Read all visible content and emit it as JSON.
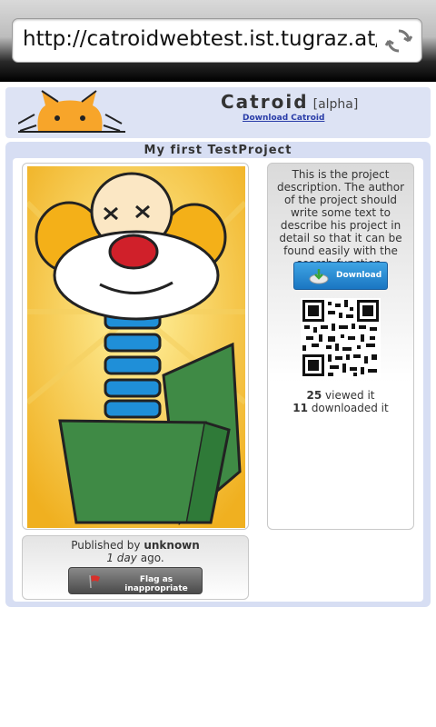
{
  "browser": {
    "url": "http://catroidwebtest.ist.tugraz.at/..."
  },
  "header": {
    "brand": "Catroid",
    "tag": "[alpha]",
    "download_link": "Download Catroid"
  },
  "project": {
    "title": "My first TestProject",
    "description": "This is the project description. The author of the project should write some text to describe his project in detail so that it can be found easily with the search-function.",
    "download_button": "Download",
    "views_count": "25",
    "views_label": "viewed it",
    "downloads_count": "11",
    "downloads_label": "downloaded it",
    "published_prefix": "Published by",
    "author": "unknown",
    "age": "1 day",
    "age_suffix": "ago.",
    "flag_button": "Flag as inappropriate"
  },
  "colors": {
    "header_bg": "#dde3f4",
    "main_bg": "#d7def3",
    "download_btn": "#2a8ad6",
    "flag_btn": "#5e5e5e",
    "link": "#2a3da8"
  }
}
